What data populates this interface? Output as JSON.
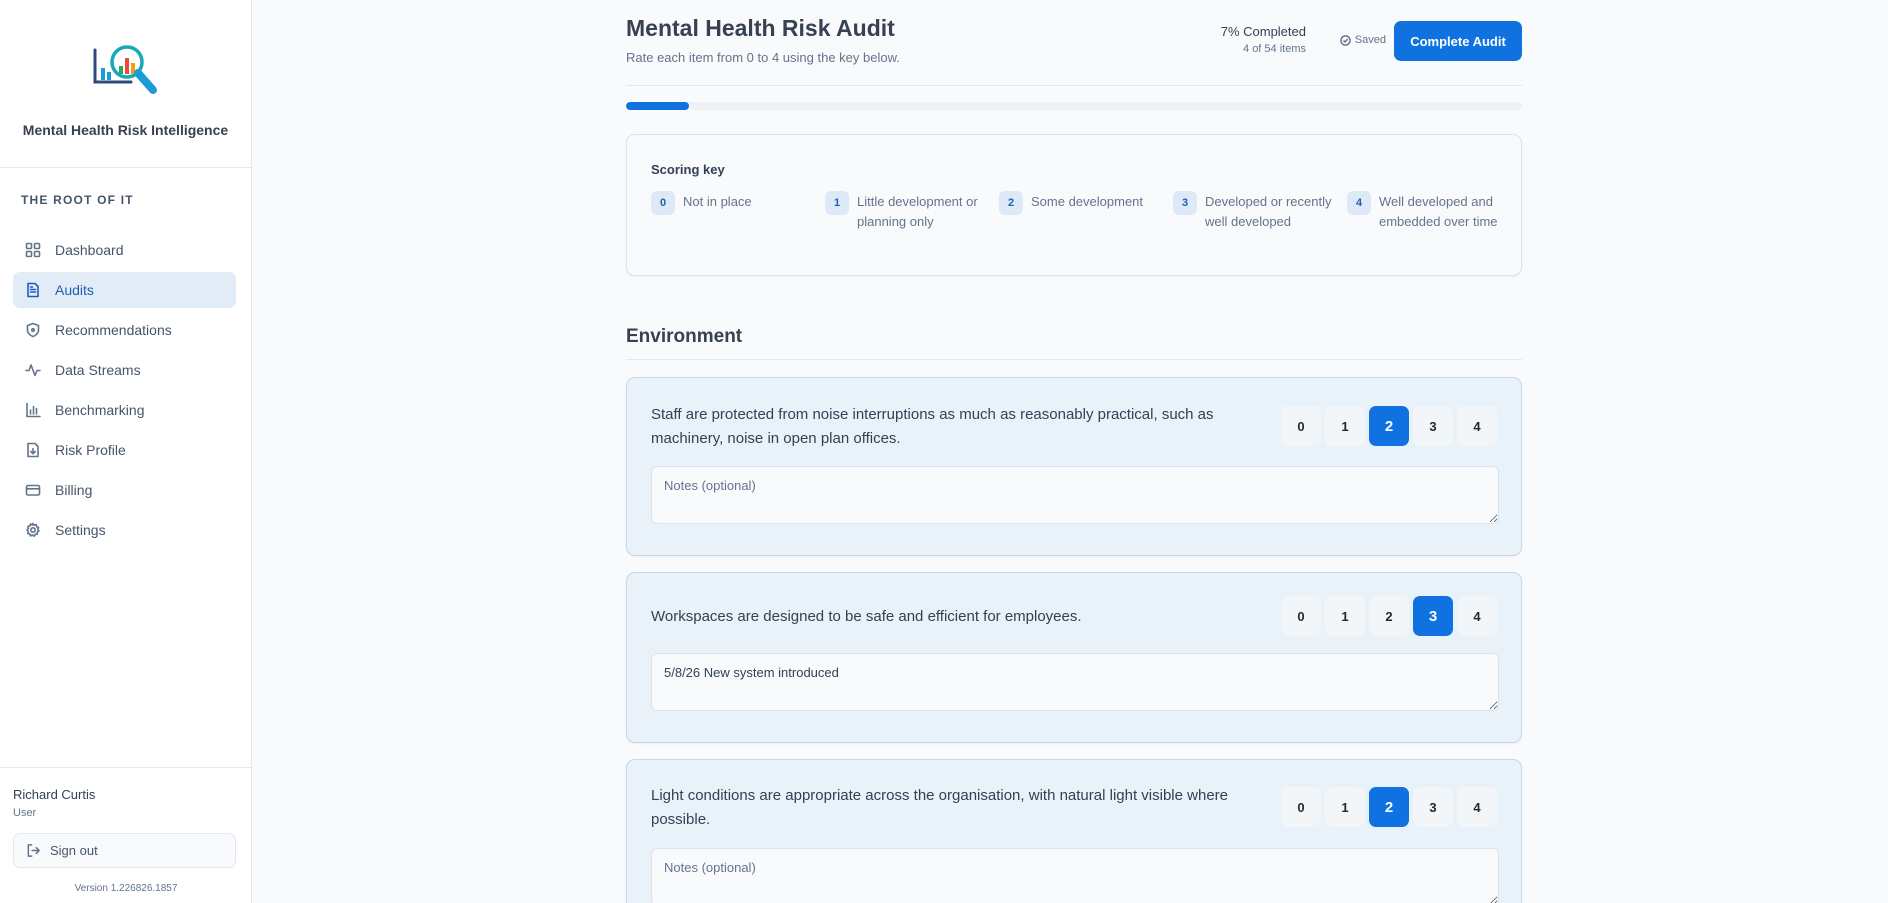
{
  "brand": {
    "name": "Mental Health Risk Intelligence",
    "logo_icon": "analytics-search-logo"
  },
  "org": {
    "label": "THE ROOT OF IT"
  },
  "nav": {
    "items": [
      {
        "label": "Dashboard",
        "icon": "grid-icon"
      },
      {
        "label": "Audits",
        "icon": "document-icon",
        "active": true
      },
      {
        "label": "Recommendations",
        "icon": "shield-icon"
      },
      {
        "label": "Data Streams",
        "icon": "activity-icon"
      },
      {
        "label": "Benchmarking",
        "icon": "bar-chart-icon"
      },
      {
        "label": "Risk Profile",
        "icon": "file-download-icon"
      },
      {
        "label": "Billing",
        "icon": "credit-card-icon"
      },
      {
        "label": "Settings",
        "icon": "gear-icon"
      }
    ]
  },
  "user": {
    "name": "Richard Curtis",
    "role": "User",
    "signout_label": "Sign out"
  },
  "version": "Version 1.226826.1857",
  "header": {
    "title": "Mental Health Risk Audit",
    "subtitle": "Rate each item from 0 to 4 using the key below.",
    "progress_label": "7% Completed",
    "progress_count": "4 of 54 items",
    "progress_fraction": 0.07,
    "saved_label": "Saved",
    "complete_button": "Complete Audit"
  },
  "scoring_key": {
    "title": "Scoring key",
    "items": [
      {
        "score": "0",
        "text": "Not in place"
      },
      {
        "score": "1",
        "text": "Little development or planning only"
      },
      {
        "score": "2",
        "text": "Some development"
      },
      {
        "score": "3",
        "text": "Developed or recently well developed"
      },
      {
        "score": "4",
        "text": "Well developed and embedded over time"
      }
    ]
  },
  "section": {
    "title": "Environment"
  },
  "questions": [
    {
      "text": "Staff are protected from noise interruptions as much as reasonably practical, such as machinery, noise in open plan offices.",
      "selected": "2",
      "notes_value": "",
      "notes_placeholder": "Notes (optional)"
    },
    {
      "text": "Workspaces are designed to be safe and efficient for employees.",
      "selected": "3",
      "notes_value": "5/8/26 New system introduced",
      "notes_placeholder": "Notes (optional)"
    },
    {
      "text": "Light conditions are appropriate across the organisation, with natural light visible where possible.",
      "selected": "2",
      "notes_value": "",
      "notes_placeholder": "Notes (optional)"
    }
  ],
  "score_options": [
    "0",
    "1",
    "2",
    "3",
    "4"
  ],
  "colors": {
    "accent": "#0f72e0",
    "active_nav_bg": "#e2ecf7",
    "card_bg": "#e9f1f9"
  }
}
